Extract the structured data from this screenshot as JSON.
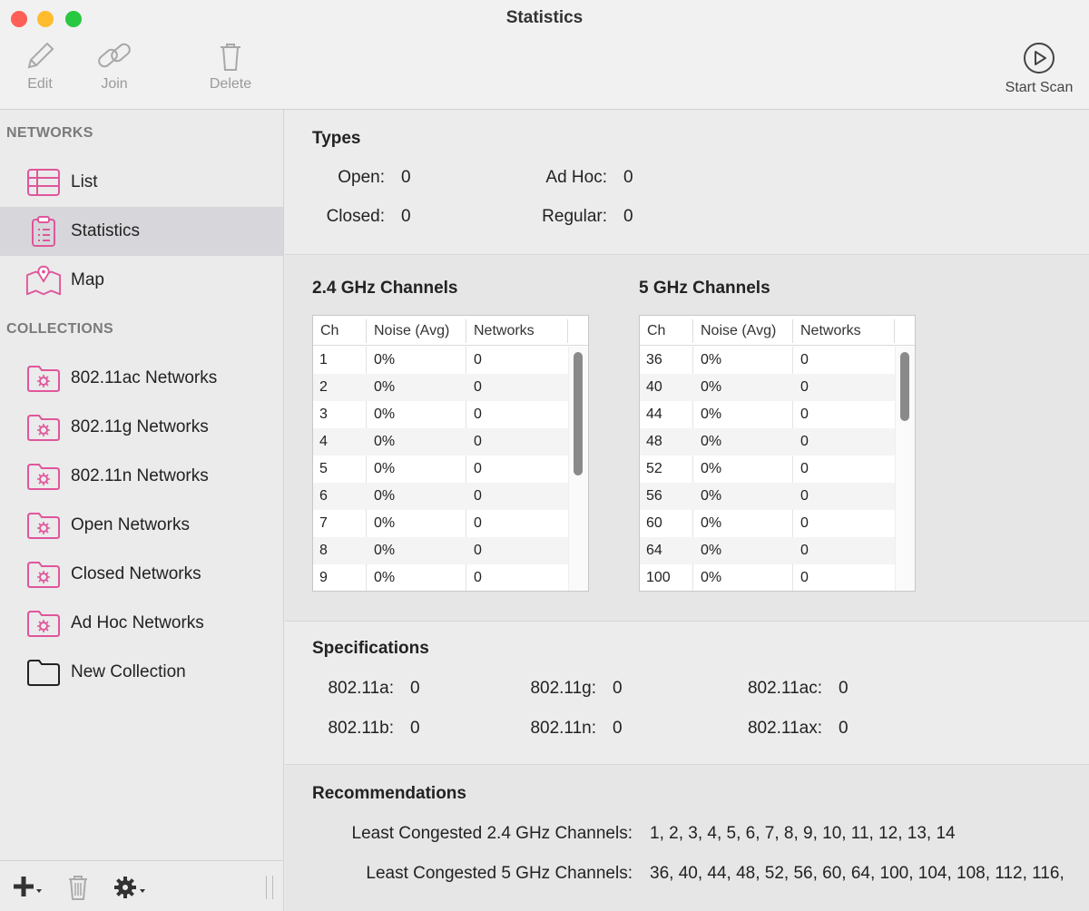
{
  "window": {
    "title": "Statistics"
  },
  "toolbar": {
    "edit": "Edit",
    "join": "Join",
    "delete": "Delete",
    "start_scan": "Start Scan"
  },
  "sidebar": {
    "networks_header": "NETWORKS",
    "networks": [
      {
        "label": "List",
        "icon": "list-icon"
      },
      {
        "label": "Statistics",
        "icon": "clipboard-icon",
        "selected": true
      },
      {
        "label": "Map",
        "icon": "map-icon"
      }
    ],
    "collections_header": "COLLECTIONS",
    "collections": [
      {
        "label": "802.11ac Networks",
        "icon": "smart-folder-icon"
      },
      {
        "label": "802.11g Networks",
        "icon": "smart-folder-icon"
      },
      {
        "label": "802.11n Networks",
        "icon": "smart-folder-icon"
      },
      {
        "label": "Open Networks",
        "icon": "smart-folder-icon"
      },
      {
        "label": "Closed Networks",
        "icon": "smart-folder-icon"
      },
      {
        "label": "Ad Hoc Networks",
        "icon": "smart-folder-icon"
      },
      {
        "label": "New Collection",
        "icon": "folder-icon"
      }
    ]
  },
  "types": {
    "title": "Types",
    "open_label": "Open:",
    "open_value": "0",
    "closed_label": "Closed:",
    "closed_value": "0",
    "adhoc_label": "Ad Hoc:",
    "adhoc_value": "0",
    "regular_label": "Regular:",
    "regular_value": "0"
  },
  "channels24": {
    "title": "2.4 GHz Channels",
    "columns": [
      "Ch",
      "Noise (Avg)",
      "Networks"
    ],
    "rows": [
      [
        "1",
        "0%",
        "0"
      ],
      [
        "2",
        "0%",
        "0"
      ],
      [
        "3",
        "0%",
        "0"
      ],
      [
        "4",
        "0%",
        "0"
      ],
      [
        "5",
        "0%",
        "0"
      ],
      [
        "6",
        "0%",
        "0"
      ],
      [
        "7",
        "0%",
        "0"
      ],
      [
        "8",
        "0%",
        "0"
      ],
      [
        "9",
        "0%",
        "0"
      ]
    ]
  },
  "channels5": {
    "title": "5 GHz Channels",
    "columns": [
      "Ch",
      "Noise (Avg)",
      "Networks"
    ],
    "rows": [
      [
        "36",
        "0%",
        "0"
      ],
      [
        "40",
        "0%",
        "0"
      ],
      [
        "44",
        "0%",
        "0"
      ],
      [
        "48",
        "0%",
        "0"
      ],
      [
        "52",
        "0%",
        "0"
      ],
      [
        "56",
        "0%",
        "0"
      ],
      [
        "60",
        "0%",
        "0"
      ],
      [
        "64",
        "0%",
        "0"
      ],
      [
        "100",
        "0%",
        "0"
      ]
    ]
  },
  "specifications": {
    "title": "Specifications",
    "a_label": "802.11a:",
    "a_value": "0",
    "b_label": "802.11b:",
    "b_value": "0",
    "g_label": "802.11g:",
    "g_value": "0",
    "n_label": "802.11n:",
    "n_value": "0",
    "ac_label": "802.11ac:",
    "ac_value": "0",
    "ax_label": "802.11ax:",
    "ax_value": "0"
  },
  "recommendations": {
    "title": "Recommendations",
    "ghz24_label": "Least Congested 2.4 GHz Channels:",
    "ghz24_value": "1, 2, 3, 4, 5, 6, 7, 8, 9, 10, 11, 12, 13, 14",
    "ghz5_label": "Least Congested 5 GHz Channels:",
    "ghz5_value": "36, 40, 44, 48, 52, 56, 60, 64, 100, 104, 108, 112, 116,"
  },
  "colors": {
    "accent": "#e0569b",
    "selection": "#d7d7db"
  }
}
